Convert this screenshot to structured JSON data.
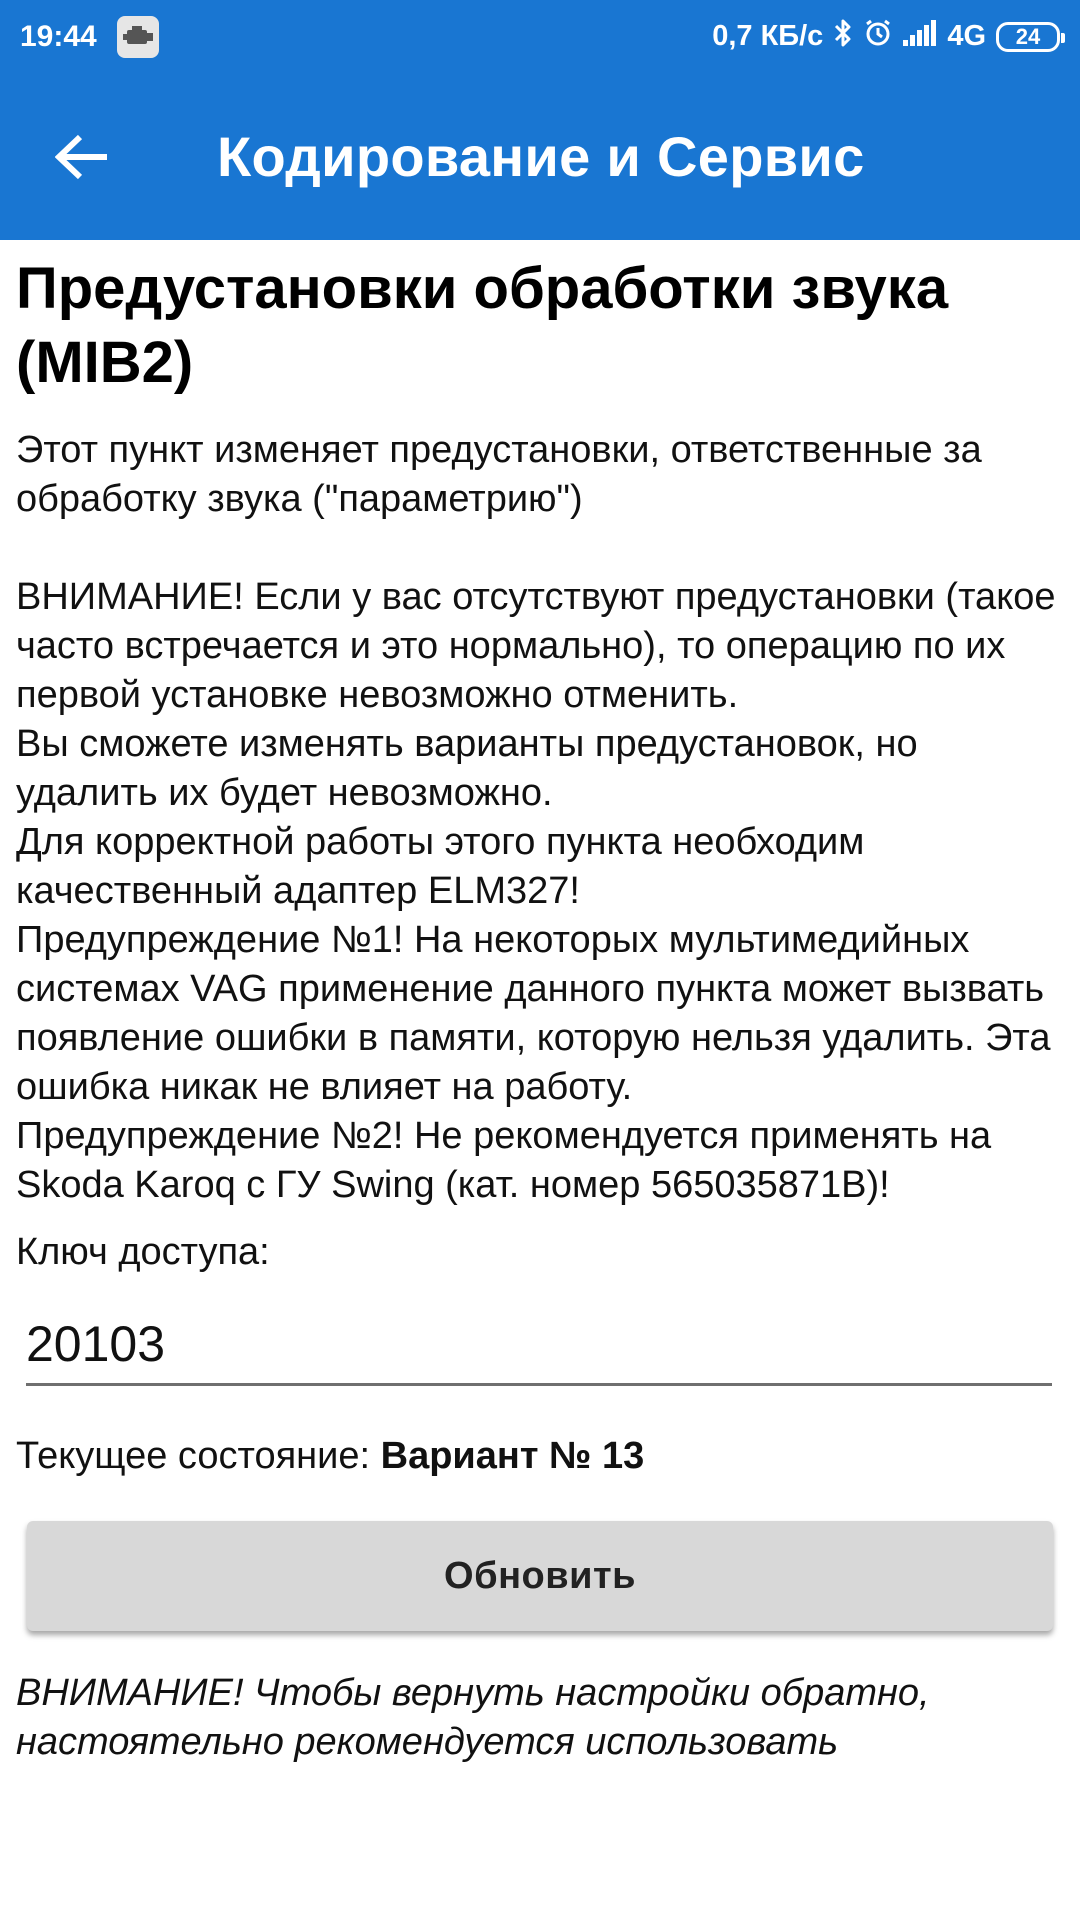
{
  "status_bar": {
    "time": "19:44",
    "network_speed": "0,7 КБ/с",
    "network_type": "4G",
    "battery": "24"
  },
  "app_bar": {
    "title": "Кодирование и Сервис"
  },
  "content": {
    "title": "Предустановки обработки звука (MIB2)",
    "intro": "Этот пункт изменяет предустановки, ответственные за обработку звука (\"параметрию\")",
    "warnings": [
      "ВНИМАНИЕ! Если у вас отсутствуют предустановки (такое часто встречается и это нормально), то операцию по их первой установке невозможно отменить.",
      "Вы сможете изменять варианты предустановок, но удалить их будет невозможно.",
      "Для корректной работы этого пункта необходим качественный адаптер ELM327!",
      "Предупреждение №1! На некоторых мультимедийных системах VAG применение данного пункта может вызвать появление ошибки в памяти, которую нельзя удалить. Эта ошибка никак не влияет на работу.",
      "Предупреждение №2! Не рекомендуется применять на Skoda Karoq с ГУ Swing (кат. номер 565035871B)!"
    ],
    "access_key_label": "Ключ доступа:",
    "access_key_value": "20103",
    "state_label": "Текущее состояние:",
    "state_value": "Вариант № 13",
    "refresh_button": "Обновить",
    "bottom_note": "ВНИМАНИЕ! Чтобы вернуть настройки обратно, настоятельно рекомендуется использовать"
  },
  "colors": {
    "primary": "#1976d2",
    "button_bg": "#d8d8d8"
  }
}
